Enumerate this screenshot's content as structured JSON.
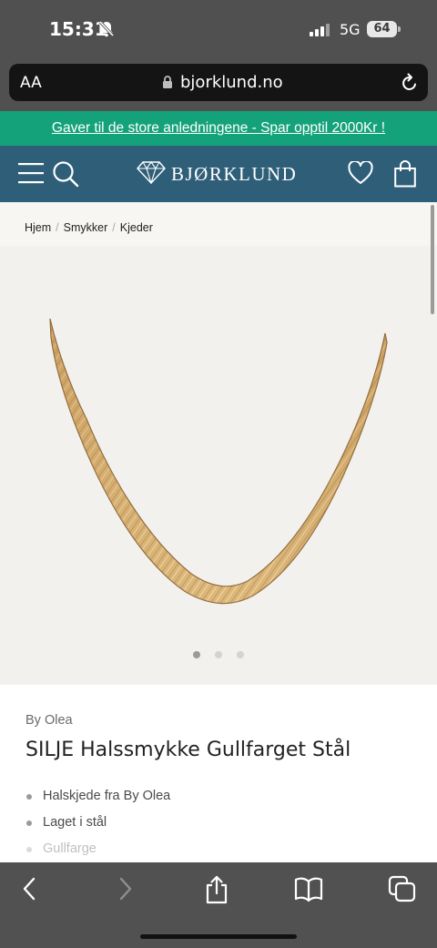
{
  "status_bar": {
    "time": "15:31",
    "network": "5G",
    "battery": "64"
  },
  "browser": {
    "text_size_label": "AA",
    "url": "bjorklund.no"
  },
  "promo_banner": {
    "text": "Gaver til de store anledningene - Spar opptil 2000Kr !"
  },
  "site_header": {
    "logo_text": "BJØRKLUND"
  },
  "breadcrumb": [
    "Hjem",
    "Smykker",
    "Kjeder"
  ],
  "gallery": {
    "image_alt": "Gold herringbone necklace",
    "slide_count": 3,
    "active_slide": 1
  },
  "product": {
    "brand": "By Olea",
    "title": "SILJE Halssmykke Gullfarget Stål",
    "features": [
      "Halskjede fra By Olea",
      "Laget i stål",
      "Gullfarge"
    ]
  },
  "colors": {
    "promo": "#14a27a",
    "header": "#2f5f78",
    "chrome": "#505050"
  }
}
